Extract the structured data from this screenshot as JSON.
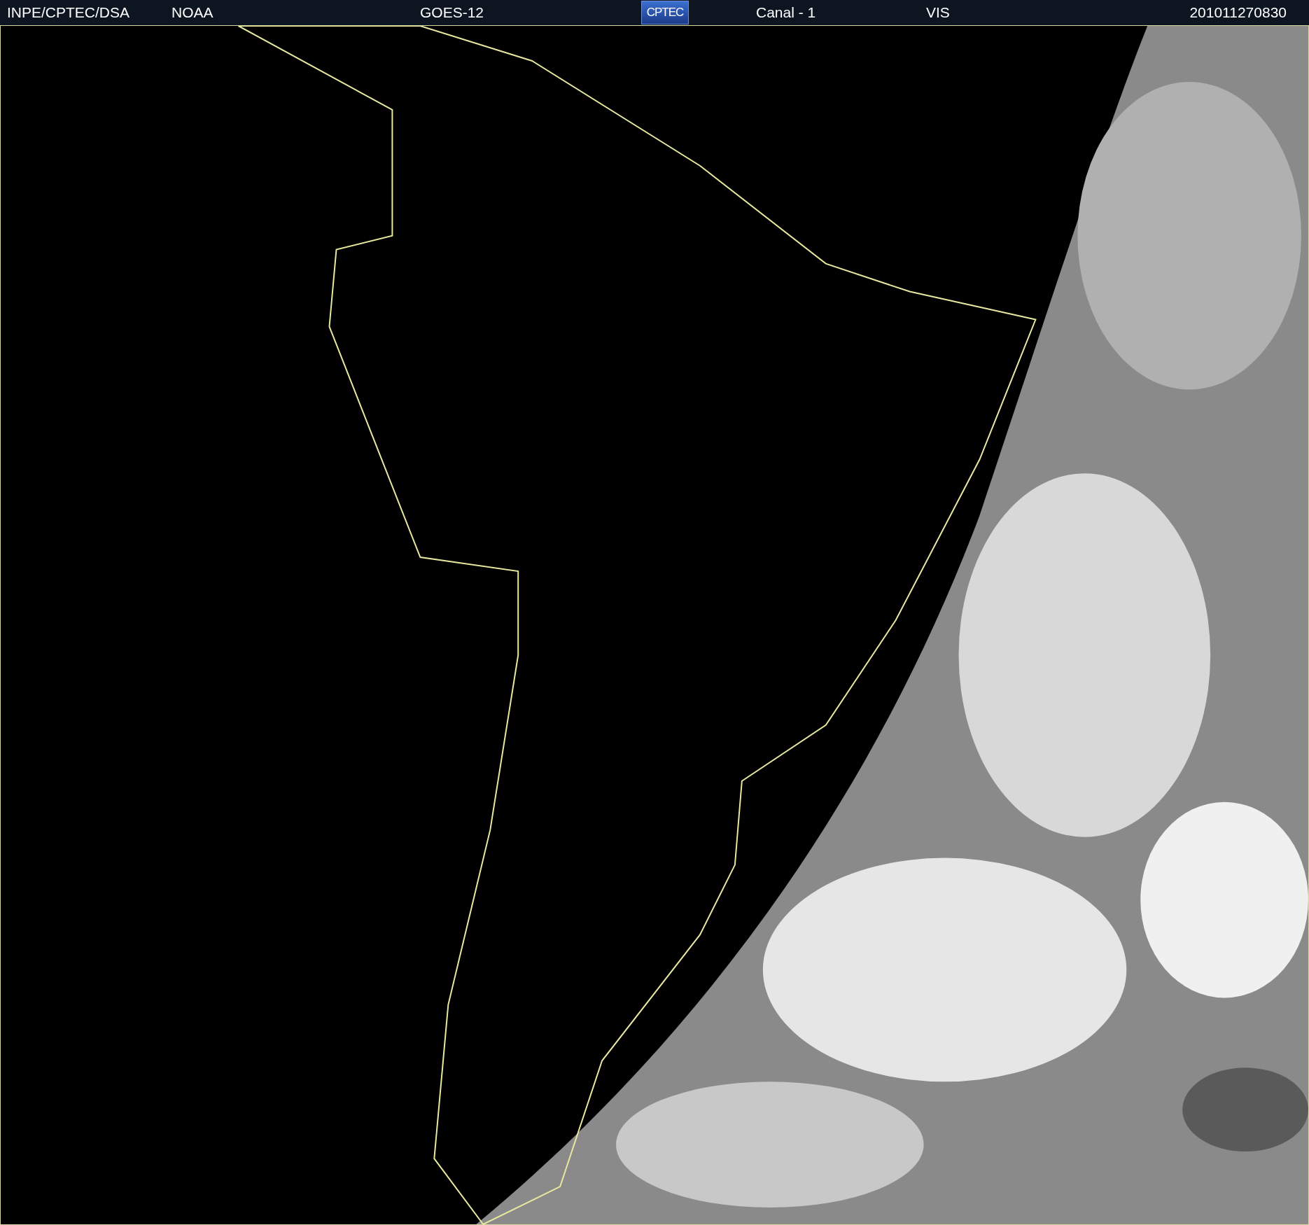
{
  "header": {
    "items": [
      {
        "kind": "text",
        "text": "INPE/CPTEC/DSA"
      },
      {
        "kind": "text",
        "text": "NOAA"
      },
      {
        "kind": "text",
        "text": "GOES-12"
      },
      {
        "kind": "logo",
        "text": "CPTEC"
      },
      {
        "kind": "text",
        "text": "Canal - 1"
      },
      {
        "kind": "text",
        "text": "VIS"
      },
      {
        "kind": "text",
        "text": "201011270830"
      }
    ]
  }
}
